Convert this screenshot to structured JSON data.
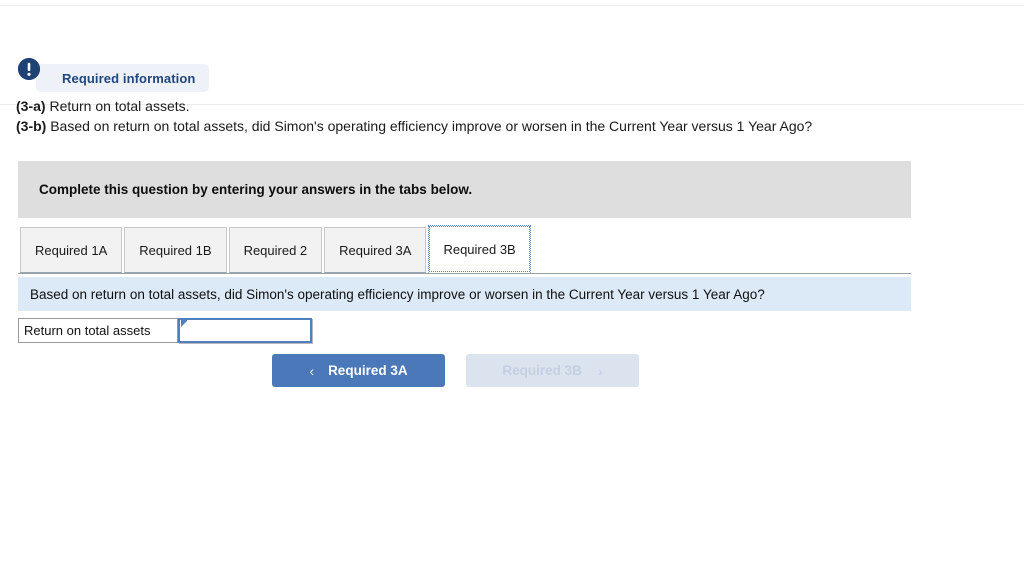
{
  "badge": {
    "icon": "exclamation-circle-icon",
    "label": "Required information",
    "icon_color": "#1f4274",
    "pill_color": "#eef2f8",
    "text_color": "#22467e"
  },
  "questions": {
    "part_a_prefix": "(3-a)",
    "part_a_text": " Return on total assets.",
    "part_b_prefix": "(3-b)",
    "part_b_text": " Based on return on total assets, did Simon's operating efficiency improve or worsen in the Current Year versus 1 Year Ago?"
  },
  "instruction": {
    "text": "Complete this question by entering your answers in the tabs below.",
    "background": "#dedede"
  },
  "tabs": {
    "items": [
      {
        "label": "Required 1A",
        "active": false
      },
      {
        "label": "Required 1B",
        "active": false
      },
      {
        "label": "Required 2",
        "active": false
      },
      {
        "label": "Required 3A",
        "active": false
      },
      {
        "label": "Required 3B",
        "active": true
      }
    ]
  },
  "question_bar": {
    "text": "Based on return on total assets, did Simon's operating efficiency improve or worsen in the Current Year versus 1 Year Ago?",
    "background": "#dce9f7"
  },
  "answer_row": {
    "label": "Return on total assets",
    "value": "",
    "placeholder": ""
  },
  "nav": {
    "prev": {
      "label": "Required 3A",
      "chevron": "‹",
      "enabled": true,
      "color": "#4a78b8"
    },
    "next": {
      "label": "Required 3B",
      "chevron": "›",
      "enabled": false,
      "color": "#dbe3ef"
    }
  }
}
